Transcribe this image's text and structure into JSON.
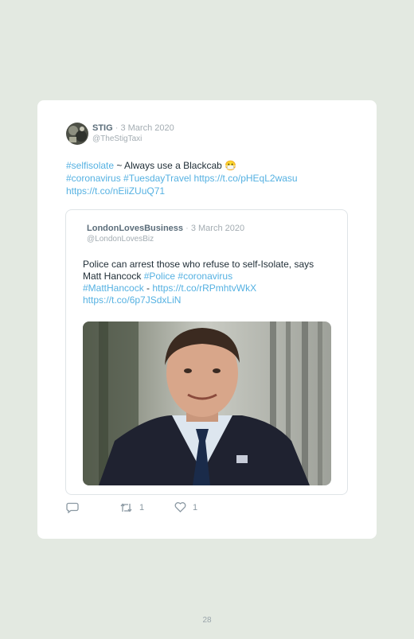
{
  "tweet": {
    "author_name": "STIG",
    "separator": "·",
    "date": "3 March 2020",
    "handle": "@TheStigTaxi",
    "text_link_1": "#selfisolate",
    "text_plain_1": " ~ Always use a Blackcab ",
    "emoji": "😷",
    "text_link_2": "#coronavirus #TuesdayTravel https://t.co/pHEqL2wasu",
    "text_link_3": "https://t.co/nEiiZUuQ71"
  },
  "quoted": {
    "author_name": "LondonLovesBusiness",
    "separator": "·",
    "date": "3 March 2020",
    "handle": "@LondonLovesBiz",
    "text_plain_1": "Police can arrest those who refuse to self-Isolate, says Matt Hancock ",
    "text_link_1": "#Police #coronavirus",
    "text_link_2": "#MattHancock",
    "text_plain_2": " - ",
    "text_link_3": "https://t.co/rRPmhtvWkX",
    "text_link_4": "https://t.co/6p7JSdxLiN"
  },
  "actions": {
    "reply_count": "",
    "retweet_count": "1",
    "like_count": "1"
  },
  "page_number": "28"
}
